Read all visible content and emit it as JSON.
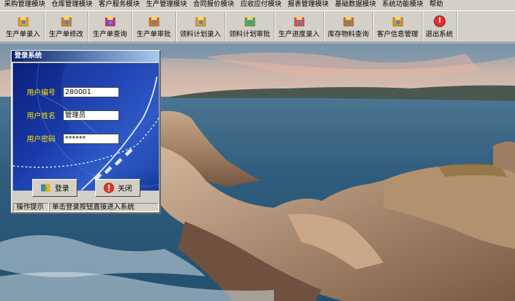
{
  "menu": [
    "采购管理模块",
    "仓库管理模块",
    "客户服务模块",
    "生产管理模块",
    "合同报价模块",
    "应收应付模块",
    "报表管理模块",
    "基础数据模块",
    "系统功能模块",
    "帮助"
  ],
  "toolbar": [
    {
      "label": "生产单录入",
      "icon": "production-entry-icon",
      "color": "#e8a020"
    },
    {
      "label": "生产单修改",
      "icon": "production-edit-icon",
      "color": "#d08030"
    },
    {
      "label": "生产单查询",
      "icon": "production-query-icon",
      "color": "#c03090"
    },
    {
      "label": "生产单审批",
      "icon": "production-approve-icon",
      "color": "#e07020"
    },
    {
      "label": "领料计划录入",
      "icon": "material-plan-entry-icon",
      "color": "#e0a030"
    },
    {
      "label": "领料计划审批",
      "icon": "material-plan-approve-icon",
      "color": "#50b050"
    },
    {
      "label": "生产进度录入",
      "icon": "progress-entry-icon",
      "color": "#e05050"
    },
    {
      "label": "库存物料查询",
      "icon": "inventory-query-icon",
      "color": "#d07020"
    },
    {
      "label": "客户信息管理",
      "icon": "customer-info-icon",
      "color": "#e09020"
    },
    {
      "label": "退出系统",
      "icon": "exit-icon",
      "color": "#e03030"
    }
  ],
  "login": {
    "title": "登录系统",
    "user_id_label": "用户编号",
    "user_id_value": "280001",
    "user_name_label": "用户姓名",
    "user_name_value": "管理员",
    "password_label": "用户密码",
    "password_value": "******",
    "login_button": "登录",
    "close_button": "关闭",
    "status_label": "操作提示",
    "status_message": "单击登录按钮直接进入系统"
  }
}
